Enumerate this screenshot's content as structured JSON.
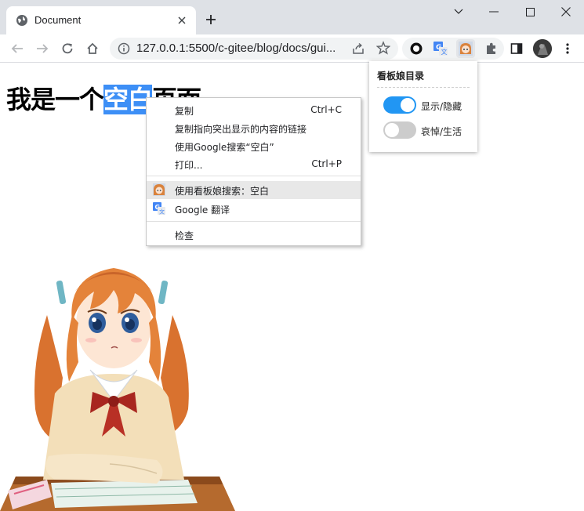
{
  "browser": {
    "tab_title": "Document",
    "url": "127.0.0.1:5500/c-gitee/blog/docs/gui...",
    "icons": [
      "globe-icon",
      "close-icon",
      "plus-icon",
      "chevron-down-icon",
      "minimize-icon",
      "maximize-icon",
      "window-close-icon",
      "back-icon",
      "forward-icon",
      "reload-icon",
      "home-icon",
      "info-icon",
      "share-icon",
      "star-icon",
      "puzzle-icon",
      "side-panel-icon",
      "more-icon"
    ]
  },
  "page": {
    "heading_before": "我是一个",
    "heading_selected": "空白",
    "heading_after": "页面",
    "selection_color": "#3d8ff6"
  },
  "context_menu": {
    "items": [
      {
        "label": "复制",
        "shortcut": "Ctrl+C"
      },
      {
        "label": "复制指向突出显示的内容的链接",
        "shortcut": ""
      },
      {
        "label": "使用Google搜索“空白”",
        "shortcut": ""
      },
      {
        "label": "打印...",
        "shortcut": "Ctrl+P"
      },
      {
        "label": "使用看板娘搜索：空白",
        "shortcut": ""
      },
      {
        "label": "Google 翻译",
        "shortcut": ""
      },
      {
        "label": "检查",
        "shortcut": ""
      }
    ]
  },
  "popup": {
    "title": "看板娘目录",
    "toggles": [
      {
        "label": "显示/隐藏",
        "on": true
      },
      {
        "label": "哀悼/生活",
        "on": false
      }
    ],
    "accent_color": "#2196f3"
  }
}
